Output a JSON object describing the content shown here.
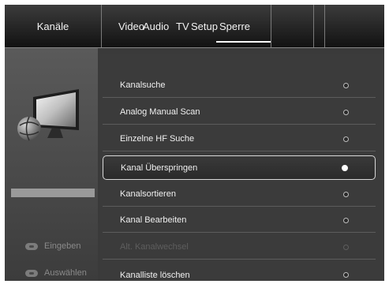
{
  "tabs": {
    "menu_title": "Kanäle",
    "video": "Video",
    "audio": "Audio",
    "tv": "TV",
    "setup": "Setup",
    "sperre": "Sperre",
    "active": "Sperre"
  },
  "sidebar": {
    "icon": "tv-globe-icon",
    "hints": [
      {
        "icon": "ok-button-icon",
        "label": "Eingeben"
      },
      {
        "icon": "navigate-button-icon",
        "label": "Auswählen"
      }
    ]
  },
  "menu": {
    "items": [
      {
        "label": "Kanalsuche",
        "state": "normal"
      },
      {
        "label": "Analog Manual Scan",
        "state": "normal"
      },
      {
        "label": "Einzelne HF Suche",
        "state": "normal"
      },
      {
        "label": "Kanal Überspringen",
        "state": "selected"
      },
      {
        "label": "Kanalsortieren",
        "state": "normal"
      },
      {
        "label": "Kanal Bearbeiten",
        "state": "normal"
      },
      {
        "label": "Alt. Kanalwechsel",
        "state": "disabled"
      },
      {
        "label": "Kanalliste löschen",
        "state": "normal"
      }
    ]
  }
}
